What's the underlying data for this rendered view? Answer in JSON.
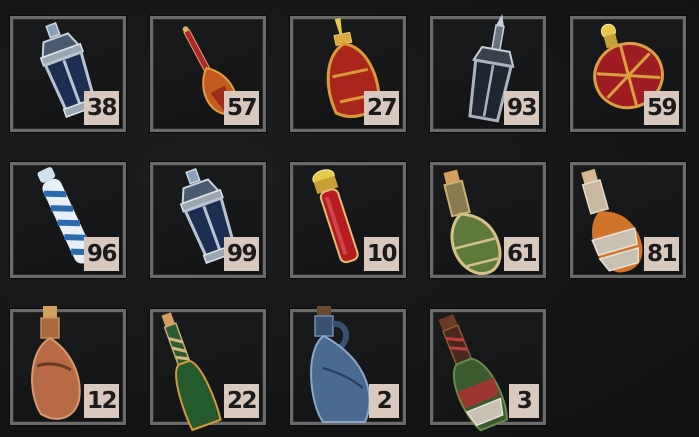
{
  "inventory": {
    "slots": [
      {
        "item_icon": "blue-lantern-flask-icon",
        "count": "38"
      },
      {
        "item_icon": "red-teardrop-vial-icon",
        "count": "57"
      },
      {
        "item_icon": "red-gold-flask-icon",
        "count": "27"
      },
      {
        "item_icon": "dark-lantern-flask-icon",
        "count": "93"
      },
      {
        "item_icon": "red-orb-flask-icon",
        "count": "59"
      },
      {
        "item_icon": "blue-striped-vial-icon",
        "count": "96"
      },
      {
        "item_icon": "blue-lantern-flask-icon",
        "count": "99"
      },
      {
        "item_icon": "red-tube-vial-icon",
        "count": "10"
      },
      {
        "item_icon": "green-corked-flask-icon",
        "count": "61"
      },
      {
        "item_icon": "orange-wrapped-bottle-icon",
        "count": "81"
      },
      {
        "item_icon": "clay-corked-flask-icon",
        "count": "12"
      },
      {
        "item_icon": "green-wine-bottle-icon",
        "count": "22"
      },
      {
        "item_icon": "blue-ceramic-jug-icon",
        "count": "2"
      },
      {
        "item_icon": "bandaged-bottle-icon",
        "count": "3"
      }
    ]
  },
  "colors": {
    "slot_border": "#6b6b6b",
    "count_badge": "#d9c8bd",
    "background": "#141516"
  }
}
